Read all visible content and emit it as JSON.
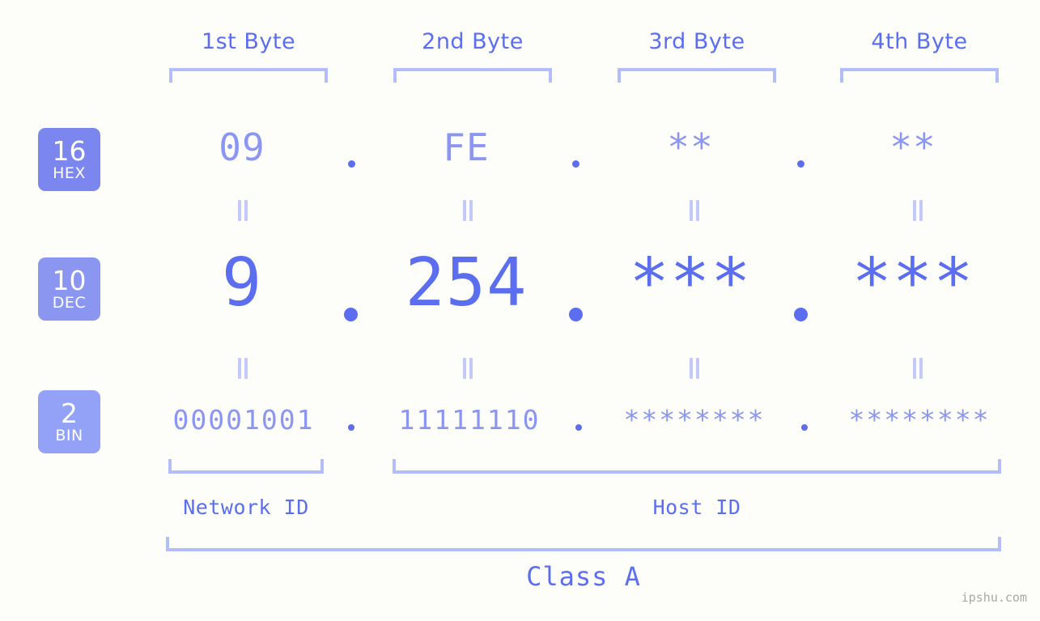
{
  "theme": {
    "background": "#fdfdfa",
    "accent_strong": "#5b6ef0",
    "accent_mid": "#8b96f1",
    "accent_light": "#b3bdf9",
    "badge_hex_bg": "#7b87ee",
    "badge_dec_bg": "#8b96f1",
    "badge_bin_bg": "#93a2f6",
    "watermark_color": "#a8a8a8"
  },
  "byte_headers": [
    {
      "label": "1st Byte"
    },
    {
      "label": "2nd Byte"
    },
    {
      "label": "3rd Byte"
    },
    {
      "label": "4th Byte"
    }
  ],
  "bases": [
    {
      "number": "16",
      "name": "HEX"
    },
    {
      "number": "10",
      "name": "DEC"
    },
    {
      "number": "2",
      "name": "BIN"
    }
  ],
  "rows": {
    "hex": {
      "base_number": "16",
      "base_name": "HEX",
      "values": [
        "09",
        "FE",
        "**",
        "**"
      ]
    },
    "dec": {
      "base_number": "10",
      "base_name": "DEC",
      "values": [
        "9",
        "254",
        "***",
        "***"
      ]
    },
    "bin": {
      "base_number": "2",
      "base_name": "BIN",
      "values": [
        "00001001",
        "11111110",
        "********",
        "********"
      ]
    }
  },
  "separators": {
    "hex": [
      ".",
      ".",
      "."
    ],
    "dec": [
      ".",
      ".",
      "."
    ],
    "bin": [
      ".",
      ".",
      "."
    ]
  },
  "equality_marks": {
    "glyph": "=",
    "row1_count": 4,
    "row2_count": 4
  },
  "regions": [
    {
      "label": "Network ID"
    },
    {
      "label": "Host ID"
    }
  ],
  "class": {
    "label": "Class A"
  },
  "watermark": {
    "text": "ipshu.com"
  }
}
